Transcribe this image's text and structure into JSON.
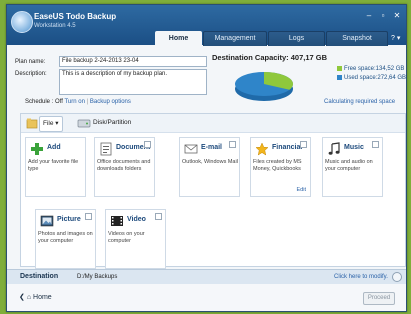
{
  "app": {
    "name": "EaseUS Todo Backup",
    "edition": "Workstation 4.5"
  },
  "tabs": [
    {
      "label": "Home",
      "active": true
    },
    {
      "label": "Management",
      "active": false
    },
    {
      "label": "Logs",
      "active": false
    },
    {
      "label": "Snapshot",
      "active": false
    }
  ],
  "form": {
    "plan_name_label": "Plan name:",
    "plan_name_value": "File backup 2-24-2013 23-04",
    "description_label": "Description:",
    "description_value": "This is a description of my backup plan.",
    "schedule_label": "Schedule : Off",
    "turn_on": "Turn on",
    "separator": "|",
    "backup_options": "Backup options"
  },
  "capacity": {
    "title": "Destination Capacity: 407,17 GB",
    "free_label": "Free space:134,52 GB",
    "used_label": "Used space:272,64 GB",
    "free_fraction": 0.33,
    "calculating": "Calculating required space",
    "colors": {
      "free": "#8fc83c",
      "used": "#2f85c9"
    }
  },
  "toolbar": {
    "file": "File",
    "disk": "Disk/Partition"
  },
  "cards": [
    {
      "title": "Add",
      "desc": "Add your favorite file type",
      "icon": "plus-icon"
    },
    {
      "title": "Document",
      "desc": "Office documents and downloads folders",
      "icon": "document-icon"
    },
    {
      "title": "E-mail",
      "desc": "Outlook, Windows Mail",
      "icon": "email-icon"
    },
    {
      "title": "Financial",
      "desc": "Files created by MS Money, Quickbooks",
      "icon": "star-icon",
      "edit": "Edit"
    },
    {
      "title": "Music",
      "desc": "Music and audio on your computer",
      "icon": "music-icon"
    },
    {
      "title": "Picture",
      "desc": "Photos and images on your computer",
      "icon": "picture-icon"
    },
    {
      "title": "Video",
      "desc": "Videos on your computer",
      "icon": "video-icon"
    }
  ],
  "destination": {
    "label": "Destination",
    "path": "D:/My Backups",
    "modify": "Click here to modify."
  },
  "footer": {
    "home": "Home",
    "proceed": "Proceed"
  }
}
